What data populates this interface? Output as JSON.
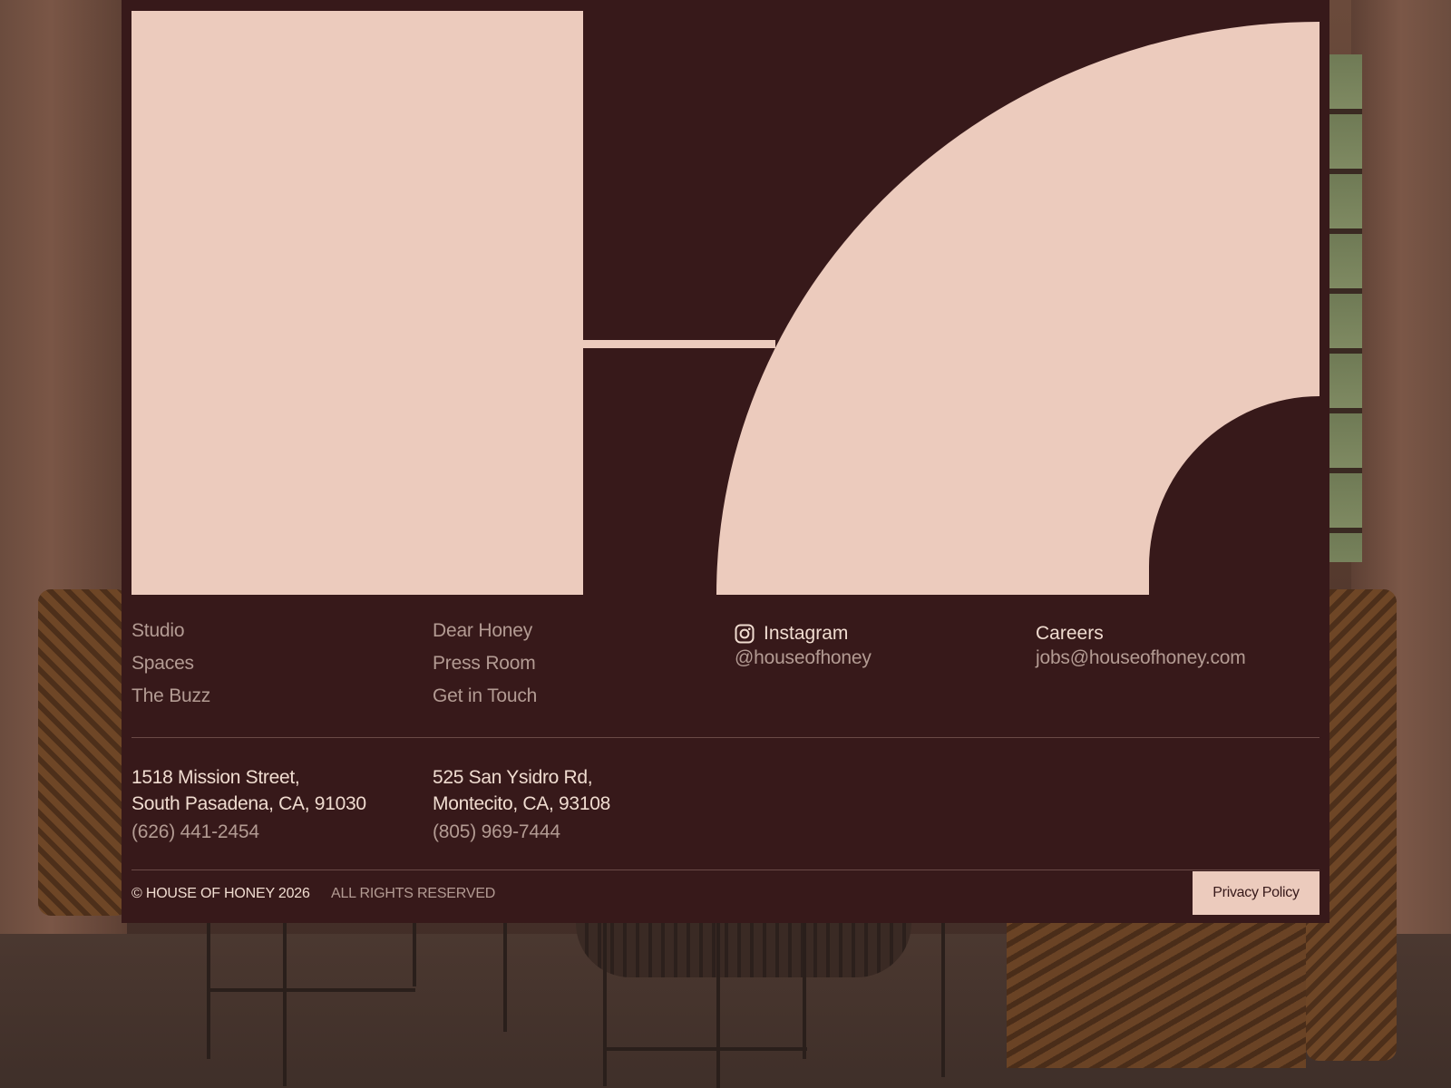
{
  "colors": {
    "panel": "#37191a",
    "logo": "#eccbbd",
    "text_primary": "#f0dcd0",
    "text_muted": "#b39b93",
    "divider": "#6a4a47"
  },
  "nav": {
    "col1": [
      "Studio",
      "Spaces",
      "The Buzz"
    ],
    "col2": [
      "Dear Honey",
      "Press Room",
      "Get in Touch"
    ]
  },
  "social": {
    "icon": "instagram-icon",
    "label": "Instagram",
    "handle": "@houseofhoney"
  },
  "careers": {
    "label": "Careers",
    "email": "jobs@houseofhoney.com"
  },
  "locations": [
    {
      "line1": "1518 Mission Street,",
      "line2": "South Pasadena, CA, 91030",
      "phone": "(626) 441-2454"
    },
    {
      "line1": "525 San Ysidro Rd,",
      "line2": "Montecito, CA, 93108",
      "phone": "(805) 969-7444"
    }
  ],
  "legal": {
    "copyright": "© HOUSE OF HONEY 2026",
    "rights": "ALL RIGHTS RESERVED",
    "privacy_label": "Privacy Policy"
  }
}
